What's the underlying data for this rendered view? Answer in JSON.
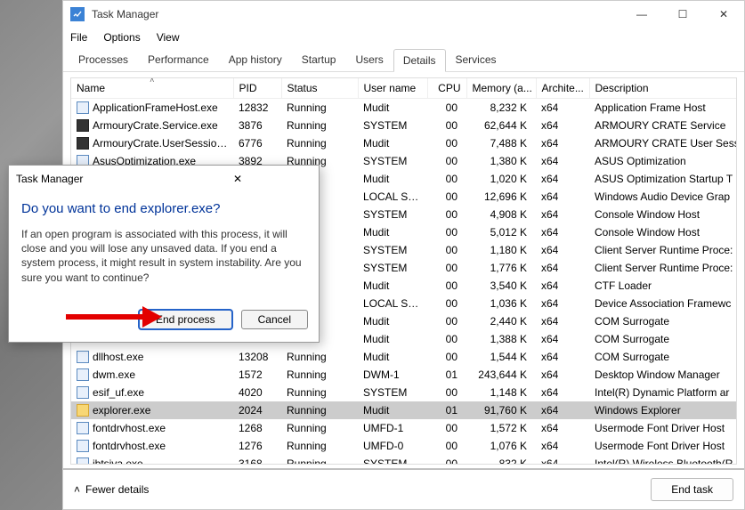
{
  "window": {
    "title": "Task Manager",
    "controls": {
      "min": "—",
      "max": "☐",
      "close": "✕"
    }
  },
  "menu": {
    "file": "File",
    "options": "Options",
    "view": "View"
  },
  "tabs": [
    "Processes",
    "Performance",
    "App history",
    "Startup",
    "Users",
    "Details",
    "Services"
  ],
  "columns": {
    "name": "Name",
    "pid": "PID",
    "status": "Status",
    "user": "User name",
    "cpu": "CPU",
    "mem": "Memory (a...",
    "arch": "Archite...",
    "desc": "Description"
  },
  "col_widths": {
    "name": "182px",
    "pid": "54px",
    "status": "86px",
    "user": "78px",
    "cpu": "44px",
    "mem": "78px",
    "arch": "60px",
    "desc": "200px"
  },
  "rows": [
    {
      "icon": "app",
      "name": "ApplicationFrameHost.exe",
      "pid": "12832",
      "status": "Running",
      "user": "Mudit",
      "cpu": "00",
      "mem": "8,232 K",
      "arch": "x64",
      "desc": "Application Frame Host"
    },
    {
      "icon": "gear",
      "name": "ArmouryCrate.Service.exe",
      "pid": "3876",
      "status": "Running",
      "user": "SYSTEM",
      "cpu": "00",
      "mem": "62,644 K",
      "arch": "x64",
      "desc": "ARMOURY CRATE Service"
    },
    {
      "icon": "gear",
      "name": "ArmouryCrate.UserSessionH...",
      "pid": "6776",
      "status": "Running",
      "user": "Mudit",
      "cpu": "00",
      "mem": "7,488 K",
      "arch": "x64",
      "desc": "ARMOURY CRATE User Sessi"
    },
    {
      "icon": "app",
      "name": "AsusOptimization.exe",
      "pid": "3892",
      "status": "Running",
      "user": "SYSTEM",
      "cpu": "00",
      "mem": "1,380 K",
      "arch": "x64",
      "desc": "ASUS Optimization"
    },
    {
      "icon": "app",
      "name": "",
      "pid": "",
      "status": "",
      "user": "Mudit",
      "cpu": "00",
      "mem": "1,020 K",
      "arch": "x64",
      "desc": "ASUS Optimization Startup T"
    },
    {
      "icon": "app",
      "name": "",
      "pid": "",
      "status": "",
      "user": "LOCAL SE...",
      "cpu": "00",
      "mem": "12,696 K",
      "arch": "x64",
      "desc": "Windows Audio Device Grap"
    },
    {
      "icon": "app",
      "name": "",
      "pid": "",
      "status": "",
      "user": "SYSTEM",
      "cpu": "00",
      "mem": "4,908 K",
      "arch": "x64",
      "desc": "Console Window Host"
    },
    {
      "icon": "app",
      "name": "",
      "pid": "",
      "status": "",
      "user": "Mudit",
      "cpu": "00",
      "mem": "5,012 K",
      "arch": "x64",
      "desc": "Console Window Host"
    },
    {
      "icon": "app",
      "name": "",
      "pid": "",
      "status": "",
      "user": "SYSTEM",
      "cpu": "00",
      "mem": "1,180 K",
      "arch": "x64",
      "desc": "Client Server Runtime Proce:"
    },
    {
      "icon": "app",
      "name": "",
      "pid": "",
      "status": "",
      "user": "SYSTEM",
      "cpu": "00",
      "mem": "1,776 K",
      "arch": "x64",
      "desc": "Client Server Runtime Proce:"
    },
    {
      "icon": "app",
      "name": "",
      "pid": "",
      "status": "",
      "user": "Mudit",
      "cpu": "00",
      "mem": "3,540 K",
      "arch": "x64",
      "desc": "CTF Loader"
    },
    {
      "icon": "app",
      "name": "",
      "pid": "",
      "status": "",
      "user": "LOCAL SE...",
      "cpu": "00",
      "mem": "1,036 K",
      "arch": "x64",
      "desc": "Device Association Framewc"
    },
    {
      "icon": "app",
      "name": "",
      "pid": "",
      "status": "",
      "user": "Mudit",
      "cpu": "00",
      "mem": "2,440 K",
      "arch": "x64",
      "desc": "COM Surrogate"
    },
    {
      "icon": "app",
      "name": "",
      "pid": "",
      "status": "",
      "user": "Mudit",
      "cpu": "00",
      "mem": "1,388 K",
      "arch": "x64",
      "desc": "COM Surrogate"
    },
    {
      "icon": "app",
      "name": "dllhost.exe",
      "pid": "13208",
      "status": "Running",
      "user": "Mudit",
      "cpu": "00",
      "mem": "1,544 K",
      "arch": "x64",
      "desc": "COM Surrogate"
    },
    {
      "icon": "app",
      "name": "dwm.exe",
      "pid": "1572",
      "status": "Running",
      "user": "DWM-1",
      "cpu": "01",
      "mem": "243,644 K",
      "arch": "x64",
      "desc": "Desktop Window Manager"
    },
    {
      "icon": "app",
      "name": "esif_uf.exe",
      "pid": "4020",
      "status": "Running",
      "user": "SYSTEM",
      "cpu": "00",
      "mem": "1,148 K",
      "arch": "x64",
      "desc": "Intel(R) Dynamic Platform ar"
    },
    {
      "icon": "folder",
      "name": "explorer.exe",
      "pid": "2024",
      "status": "Running",
      "user": "Mudit",
      "cpu": "01",
      "mem": "91,760 K",
      "arch": "x64",
      "desc": "Windows Explorer",
      "selected": true
    },
    {
      "icon": "app",
      "name": "fontdrvhost.exe",
      "pid": "1268",
      "status": "Running",
      "user": "UMFD-1",
      "cpu": "00",
      "mem": "1,572 K",
      "arch": "x64",
      "desc": "Usermode Font Driver Host"
    },
    {
      "icon": "app",
      "name": "fontdrvhost.exe",
      "pid": "1276",
      "status": "Running",
      "user": "UMFD-0",
      "cpu": "00",
      "mem": "1,076 K",
      "arch": "x64",
      "desc": "Usermode Font Driver Host"
    },
    {
      "icon": "app",
      "name": "ibtsiva.exe",
      "pid": "3168",
      "status": "Running",
      "user": "SYSTEM",
      "cpu": "00",
      "mem": "832 K",
      "arch": "x64",
      "desc": "Intel(R) Wireless Bluetooth(R"
    }
  ],
  "footer": {
    "fewer": "Fewer details",
    "end_task": "End task"
  },
  "dialog": {
    "title": "Task Manager",
    "headline": "Do you want to end explorer.exe?",
    "body": "If an open program is associated with this process, it will close and you will lose any unsaved data. If you end a system process, it might result in system instability. Are you sure you want to continue?",
    "end": "End process",
    "cancel": "Cancel",
    "close": "✕"
  }
}
